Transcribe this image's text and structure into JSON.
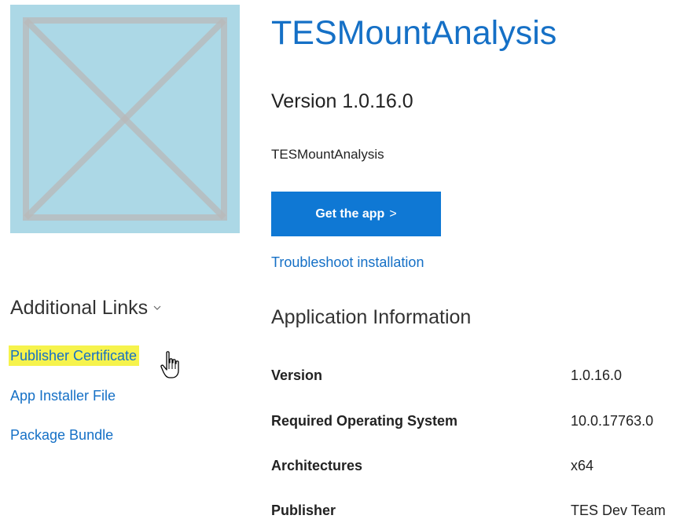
{
  "app": {
    "title": "TESMountAnalysis",
    "version_line": "Version 1.0.16.0",
    "publisher_display": "TESMountAnalysis",
    "get_app_label": "Get the app",
    "get_app_chevron": ">",
    "troubleshoot_label": "Troubleshoot installation",
    "logo_color": "#acd8e6"
  },
  "additional_links": {
    "header": "Additional Links",
    "items": [
      {
        "label": "Publisher Certificate",
        "highlighted": true
      },
      {
        "label": "App Installer File"
      },
      {
        "label": "Package Bundle"
      }
    ]
  },
  "application_information": {
    "heading": "Application Information",
    "rows": [
      {
        "label": "Version",
        "value": "1.0.16.0"
      },
      {
        "label": "Required Operating System",
        "value": "10.0.17763.0"
      },
      {
        "label": "Architectures",
        "value": "x64"
      },
      {
        "label": "Publisher",
        "value": "TES Dev Team"
      }
    ]
  },
  "colors": {
    "accent": "#1570c6",
    "button": "#0f78d4",
    "highlight": "#f6f34c"
  }
}
